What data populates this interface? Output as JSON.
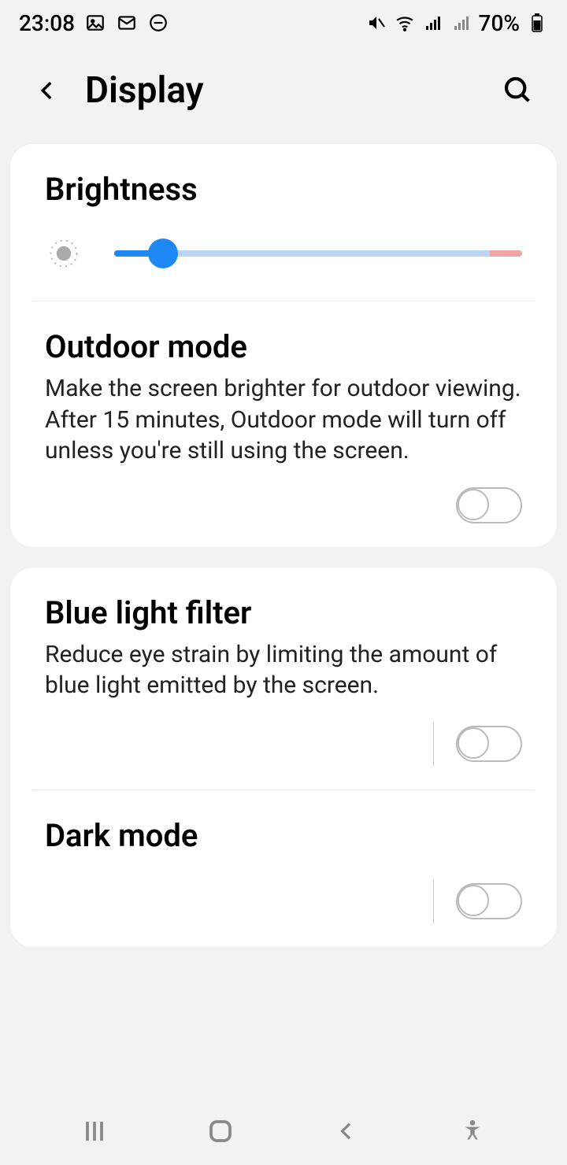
{
  "status": {
    "time": "23:08",
    "battery_text": "70%",
    "icons_left": [
      "image-icon",
      "mail-icon",
      "do-not-disturb-icon"
    ],
    "icons_right": [
      "mute-icon",
      "wifi-icon",
      "signal-icon",
      "signal-icon-2"
    ]
  },
  "header": {
    "title": "Display"
  },
  "brightness": {
    "title": "Brightness",
    "slider_percent": 12
  },
  "outdoor": {
    "title": "Outdoor mode",
    "description": "Make the screen brighter for outdoor viewing. After 15 minutes, Outdoor mode will turn off unless you're still using the screen.",
    "enabled": false
  },
  "bluelight": {
    "title": "Blue light filter",
    "description": "Reduce eye strain by limiting the amount of blue light emitted by the screen.",
    "enabled": false
  },
  "darkmode": {
    "title": "Dark mode",
    "enabled": false
  }
}
